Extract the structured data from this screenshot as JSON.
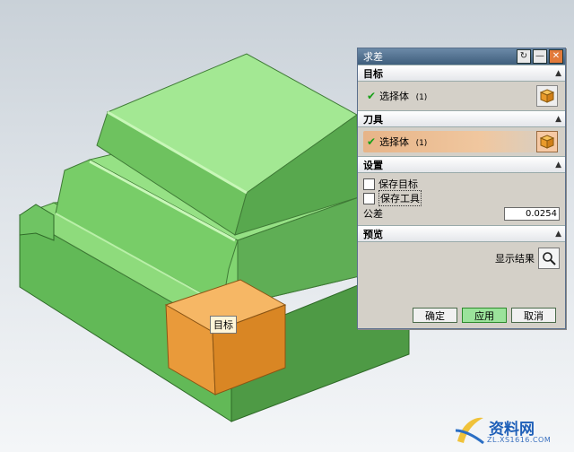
{
  "viewport": {
    "target_label": "目标",
    "colors": {
      "body": "#7cd36a",
      "tool": "#f0a03c"
    }
  },
  "dialog": {
    "title": "求差",
    "controls": {
      "reset": "reset-icon",
      "minimize": "minimize-icon",
      "close": "close-icon"
    },
    "target_section": {
      "header": "目标",
      "row_label": "选择体",
      "count": "(1)"
    },
    "tool_section": {
      "header": "刀具",
      "row_label": "选择体",
      "count": "(1)"
    },
    "settings_section": {
      "header": "设置",
      "keep_target": "保存目标",
      "keep_tool": "保存工具",
      "tolerance_label": "公差",
      "tolerance_value": "0.0254"
    },
    "preview_section": {
      "header": "预览",
      "show_result": "显示结果"
    },
    "buttons": {
      "ok": "确定",
      "apply": "应用",
      "cancel": "取消"
    }
  },
  "watermark": {
    "text": "资料网",
    "url": "ZL.XS1616.COM"
  }
}
